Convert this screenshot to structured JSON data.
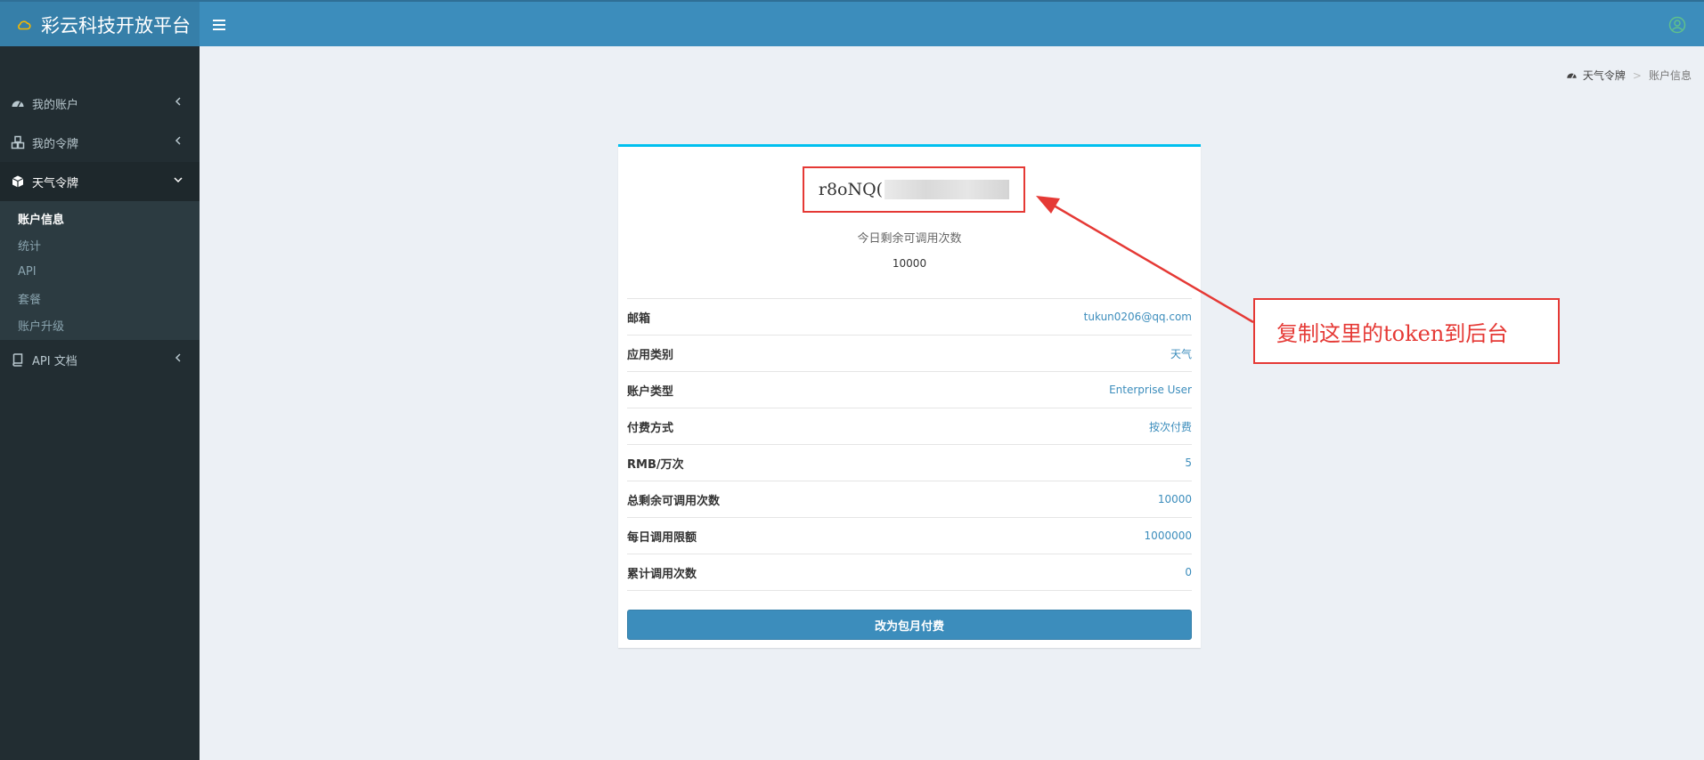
{
  "app": {
    "title": "彩云科技开放平台"
  },
  "colors": {
    "brand": "#3c8dbc",
    "sidebar": "#222d32",
    "accent_border": "#00c0ef",
    "annotation": "#e53935"
  },
  "sidebar": {
    "items": [
      {
        "label": "我的账户",
        "icon": "dashboard-icon"
      },
      {
        "label": "我的令牌",
        "icon": "cubes-icon"
      },
      {
        "label": "天气令牌",
        "icon": "cube-icon",
        "active": true
      }
    ],
    "submenu": [
      {
        "label": "账户信息",
        "active": true
      },
      {
        "label": "统计"
      },
      {
        "label": "API"
      },
      {
        "label": "套餐"
      },
      {
        "label": "账户升级"
      }
    ],
    "docs": {
      "label": "API 文档",
      "icon": "book-icon"
    }
  },
  "breadcrumb": {
    "parent": "天气令牌",
    "current": "账户信息"
  },
  "card": {
    "token_visible": "r8oNQ(",
    "remaining_label": "今日剩余可调用次数",
    "remaining_value": "10000",
    "rows": [
      {
        "key": "邮箱",
        "value": "tukun0206@qq.com"
      },
      {
        "key": "应用类别",
        "value": "天气"
      },
      {
        "key": "账户类型",
        "value": "Enterprise User"
      },
      {
        "key": "付费方式",
        "value": "按次付费"
      },
      {
        "key": "RMB/万次",
        "value": "5"
      },
      {
        "key": "总剩余可调用次数",
        "value": "10000"
      },
      {
        "key": "每日调用限额",
        "value": "1000000"
      },
      {
        "key": "累计调用次数",
        "value": "0"
      }
    ],
    "action_label": "改为包月付费"
  },
  "annotation": {
    "text": "复制这里的token到后台"
  }
}
